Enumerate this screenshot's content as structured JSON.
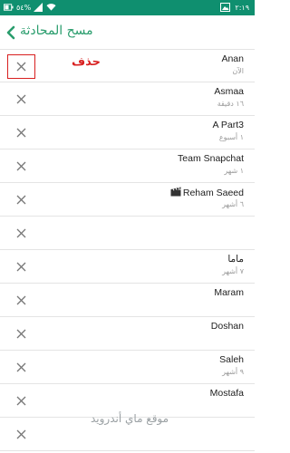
{
  "status_bar": {
    "time": "٢:١٩",
    "battery": "٥٤%"
  },
  "header": {
    "title": "مسح المحادثة"
  },
  "annotation": {
    "delete_label": "حذف"
  },
  "conversations": [
    {
      "name": "Anan",
      "time": "الآن"
    },
    {
      "name": "Asmaa",
      "time": "١٦ دقيقة"
    },
    {
      "name": "A Part3",
      "time": "١ أسبوع"
    },
    {
      "name": "Team Snapchat",
      "time": "١ شهر"
    },
    {
      "name": "Reham Saeed",
      "time": "٦ أشهر"
    },
    {
      "name": "",
      "time": ""
    },
    {
      "name": "ماما",
      "time": "٧ أشهر"
    },
    {
      "name": "Maram",
      "time": ""
    },
    {
      "name": "Doshan",
      "time": ""
    },
    {
      "name": "Saleh",
      "time": "٩ أشهر"
    },
    {
      "name": "Mostafa",
      "time": ""
    },
    {
      "name": "",
      "time": ""
    }
  ],
  "watermark": "موقع ماي أندرويد",
  "colors": {
    "status_bar": "#0f8f6f",
    "accent_green": "#2a9d6d",
    "highlight_red": "#d81f1f"
  }
}
